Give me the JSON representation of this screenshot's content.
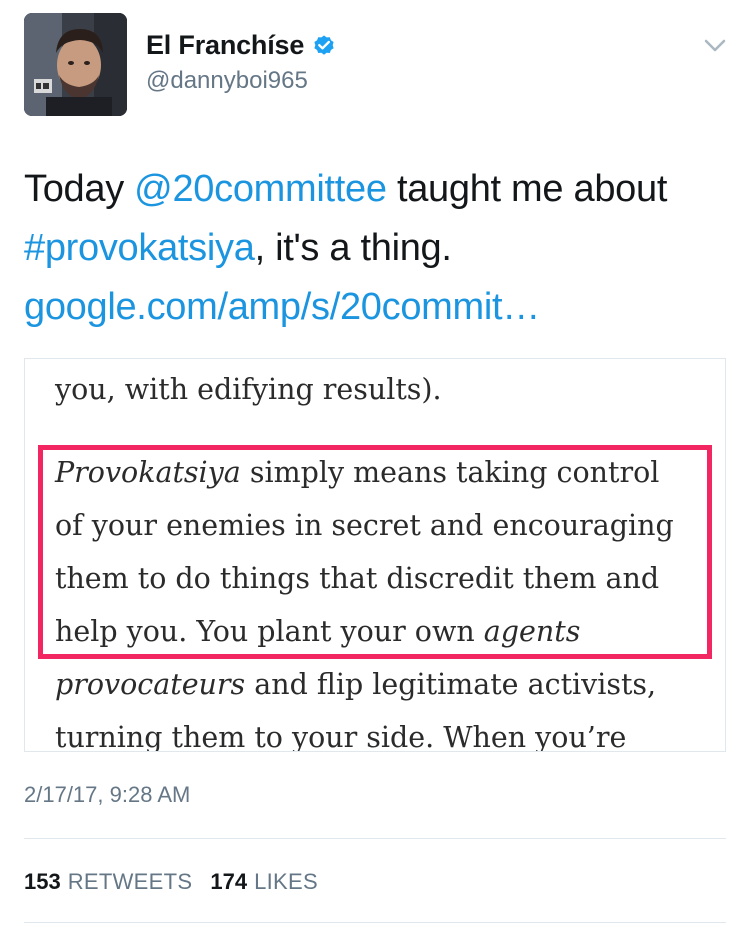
{
  "author": {
    "display_name": "El Franchíse",
    "handle": "@dannyboi965",
    "verified": true,
    "avatar_icon": "profile-photo"
  },
  "tweet": {
    "segments": [
      {
        "text": "Today ",
        "type": "text"
      },
      {
        "text": "@20committee",
        "type": "mention"
      },
      {
        "text": " taught me about ",
        "type": "text"
      },
      {
        "text": "#provokatsiya",
        "type": "hashtag"
      },
      {
        "text": ", it's a thing. ",
        "type": "text"
      },
      {
        "text": "google.com/amp/s/20commit…",
        "type": "url"
      }
    ]
  },
  "media_image": {
    "lines": [
      "you, with edifying results).",
      "Provokatsiya simply means taking control",
      "of your enemies in secret and encouraging",
      "them to do things that discredit them and",
      "help you. You plant your own agents",
      "provocateurs and flip legitimate activists,",
      "turning them to your side. When you’re"
    ]
  },
  "timestamp": "2/17/17, 9:28 AM",
  "stats": {
    "retweets_count": "153",
    "retweets_label": "RETWEETS",
    "likes_count": "174",
    "likes_label": "LIKES"
  },
  "colors": {
    "link": "#1b95e0",
    "secondary_text": "#657786",
    "highlight_border": "#f22762",
    "verified_badge": "#1da1f2"
  }
}
